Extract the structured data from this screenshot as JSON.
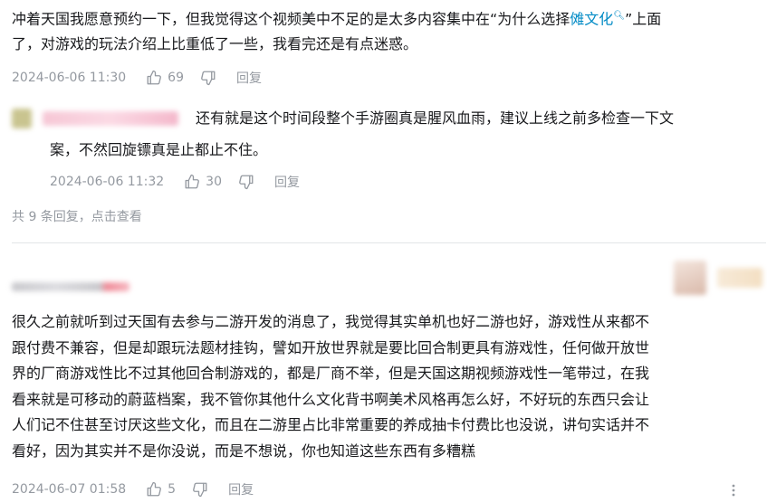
{
  "comment1": {
    "text_before": "冲着天国我愿意预约一下，但我觉得这个视频美中不足的是太多内容集中在“为什么选择",
    "link_text": "傩文化",
    "text_after_line1": "”上面",
    "text_line2": "了，对游戏的玩法介绍上比重低了一些，我看完还是有点迷惑。",
    "date": "2024-06-06 11:30",
    "likes": "69",
    "reply_label": "回复"
  },
  "reply1": {
    "text_line1": "还有就是这个时间段整个手游圈真是腥风血雨，建议上线之前多检查一下文",
    "text_line2": "案，不然回旋镖真是止都止不住。",
    "date": "2024-06-06 11:32",
    "likes": "30",
    "reply_label": "回复"
  },
  "replies_summary": "共 9 条回复，点击查看",
  "comment2": {
    "lines": [
      "很久之前就听到过天国有去参与二游开发的消息了，我觉得其实单机也好二游也好，游戏性从来都不",
      "跟付费不兼容，但是却跟玩法题材挂钩，譬如开放世界就是要比回合制更具有游戏性，任何做开放世",
      "界的厂商游戏性比不过其他回合制游戏的，都是厂商不举，但是天国这期视频游戏性一笔带过，在我",
      "看来就是可移动的蔚蓝档案，我不管你其他什么文化背书啊美术风格再怎么好，不好玩的东西只会让",
      "人们记不住甚至讨厌这些文化，而且在二游里占比非常重要的养成抽卡付费比也没说，讲句实话并不",
      "看好，因为其实并不是你没说，而是不想说，你也知道这些东西有多糟糕"
    ],
    "date": "2024-06-07 01:58",
    "likes": "5",
    "reply_label": "回复"
  },
  "colors": {
    "link": "#008ac5",
    "meta": "#9499a0",
    "text": "#18191c"
  }
}
